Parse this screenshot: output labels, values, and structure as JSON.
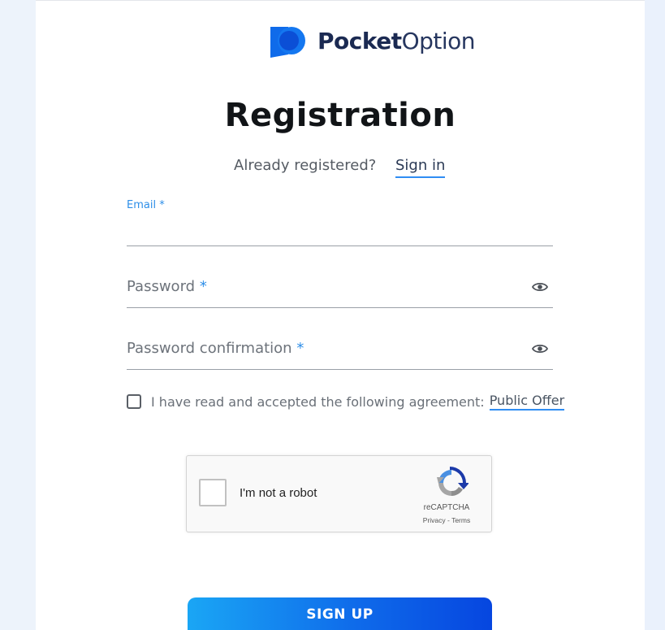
{
  "brand": {
    "name_bold": "Pocket",
    "name_light": "Option",
    "logo_icon": "pocketoption-logo-icon",
    "colors": {
      "primary": "#0f6bea",
      "accent": "#2f8df3",
      "dark": "#1b2a52"
    }
  },
  "page": {
    "title": "Registration",
    "already_text": "Already registered?",
    "signin_label": "Sign in"
  },
  "form": {
    "email": {
      "label": "Email *",
      "value": ""
    },
    "password": {
      "placeholder": "Password",
      "required_mark": "*",
      "icon": "eye-icon"
    },
    "password_confirmation": {
      "placeholder": "Password confirmation",
      "required_mark": "*",
      "icon": "eye-icon"
    },
    "agreement": {
      "text": "I have read and accepted the following agreement:",
      "link": "Public Offer",
      "checked": false
    }
  },
  "recaptcha": {
    "label": "I'm not a robot",
    "brand": "reCAPTCHA",
    "links": "Privacy - Terms",
    "icon": "recaptcha-logo-icon"
  },
  "submit": {
    "label": "SIGN UP"
  }
}
